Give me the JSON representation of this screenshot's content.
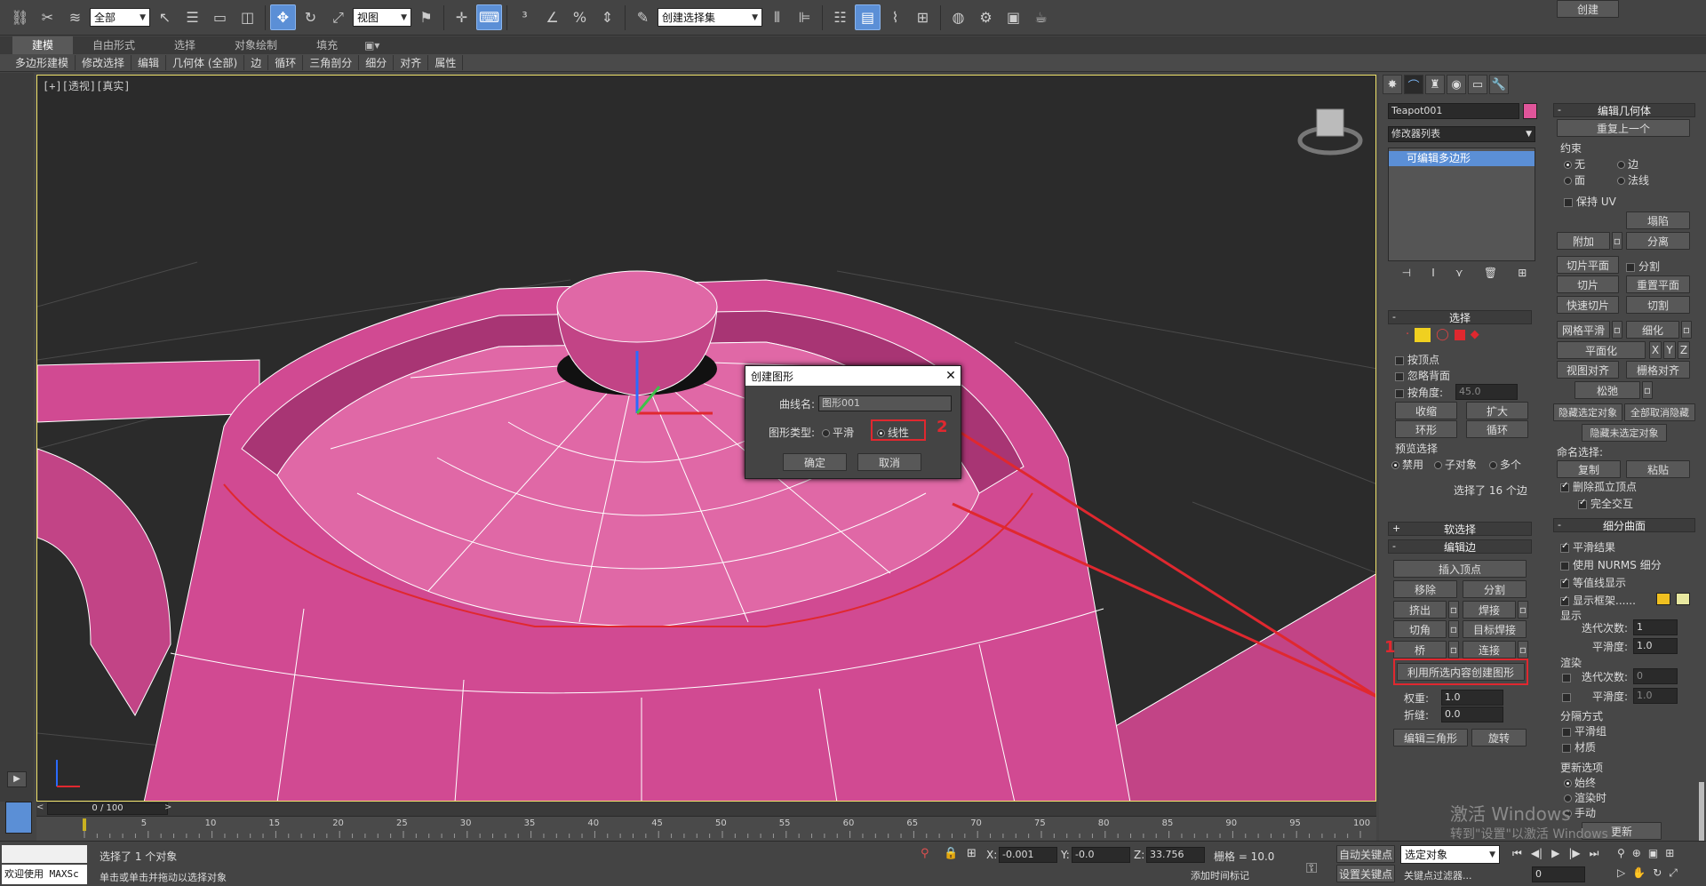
{
  "toolbar": {
    "select_filter": "全部",
    "ref_coord": "视图",
    "named_selection": "创建选择集"
  },
  "ribbon": {
    "tabs": [
      "建模",
      "自由形式",
      "选择",
      "对象绘制",
      "填充"
    ],
    "sub_items": [
      "多边形建模",
      "修改选择",
      "编辑",
      "几何体 (全部)",
      "边",
      "循环",
      "三角剖分",
      "细分",
      "对齐",
      "属性"
    ]
  },
  "viewport": {
    "label": "[+][透视][真实]"
  },
  "dialog": {
    "title": "创建图形",
    "curve_name_label": "曲线名:",
    "curve_name_value": "图形001",
    "shape_type_label": "图形类型:",
    "option_smooth": "平滑",
    "option_linear": "线性",
    "ok_label": "确定",
    "cancel_label": "取消"
  },
  "annotations": {
    "num1": "1",
    "num2": "2"
  },
  "command_panel": {
    "object_name": "Teapot001",
    "modifier_list": "修改器列表",
    "stack_item": "可编辑多边形",
    "selection": {
      "title": "选择",
      "by_vertex": "按顶点",
      "ignore_backface": "忽略背面",
      "by_angle": "按角度:",
      "angle_value": "45.0",
      "shrink": "收缩",
      "grow": "扩大",
      "ring": "环形",
      "loop": "循环",
      "preview_title": "预览选择",
      "preview_off": "禁用",
      "preview_subobj": "子对象",
      "preview_multi": "多个",
      "status": "选择了 16 个边"
    },
    "soft_selection": "软选择",
    "edit_edges": {
      "title": "编辑边",
      "insert_vertex": "插入顶点",
      "remove": "移除",
      "split": "分割",
      "extrude": "挤出",
      "weld": "焊接",
      "chamfer": "切角",
      "target_weld": "目标焊接",
      "bridge": "桥",
      "connect": "连接",
      "create_shape": "利用所选内容创建图形",
      "weight_label": "权重:",
      "weight_value": "1.0",
      "crease_label": "折缝:",
      "crease_value": "0.0",
      "edit_tri": "编辑三角形",
      "turn": "旋转"
    },
    "edit_geometry": {
      "title": "编辑几何体",
      "repeat_last": "重复上一个",
      "constraints": "约束",
      "c_none": "无",
      "c_edge": "边",
      "c_face": "面",
      "c_normal": "法线",
      "preserve_uv": "保持 UV",
      "create": "创建",
      "collapse": "塌陷",
      "attach": "附加",
      "detach": "分离",
      "slice_plane": "切片平面",
      "split": "分割",
      "slice": "切片",
      "reset_plane": "重置平面",
      "quickslice": "快速切片",
      "cut": "切割",
      "meshsmooth": "网格平滑",
      "tessellate": "细化",
      "planarize": "平面化",
      "x": "X",
      "y": "Y",
      "z": "Z",
      "view_align": "视图对齐",
      "grid_align": "栅格对齐",
      "relax": "松弛",
      "hide_sel": "隐藏选定对象",
      "unhide_all": "全部取消隐藏",
      "hide_unsel": "隐藏未选定对象",
      "named_sel": "命名选择:",
      "copy": "复制",
      "paste": "粘贴",
      "delete_iso": "删除孤立顶点",
      "full_interact": "完全交互"
    },
    "subdivision": {
      "title": "细分曲面",
      "smooth_result": "平滑结果",
      "use_nurms": "使用 NURMS 细分",
      "isoline": "等值线显示",
      "show_cage": "显示框架......",
      "display": "显示",
      "iterations": "迭代次数:",
      "iter_value": "1",
      "smoothness": "平滑度:",
      "smooth_value": "1.0",
      "render": "渲染",
      "r_iterations": "迭代次数:",
      "r_iter_value": "0",
      "r_smoothness": "平滑度:",
      "r_smooth_value": "1.0",
      "sep_by": "分隔方式",
      "sm_groups": "平滑组",
      "materials": "材质",
      "update_opts": "更新选项",
      "always": "始终",
      "when_render": "渲染时",
      "manually": "手动",
      "update": "更新"
    }
  },
  "timeline": {
    "frame": "0 / 100",
    "ticks": [
      "5",
      "10",
      "15",
      "20",
      "25",
      "30",
      "35",
      "40",
      "45",
      "50",
      "55",
      "60",
      "65",
      "70",
      "75",
      "80",
      "85",
      "90",
      "95",
      "100"
    ]
  },
  "status": {
    "welcome": "欢迎使用 MAXSc",
    "selected": "选择了 1 个对象",
    "prompt": "单击或单击并拖动以选择对象",
    "x_label": "X:",
    "x_val": "-0.001",
    "y_label": "Y:",
    "y_val": "-0.0",
    "z_label": "Z:",
    "z_val": "33.756",
    "grid": "栅格 = 10.0",
    "auto_key": "自动关键点",
    "set_key": "设置关键点",
    "sel_obj": "选定对象",
    "key_filters": "关键点过滤器...",
    "add_time_tag": "添加时间标记",
    "frame_val": "0"
  },
  "watermark": {
    "line1": "激活 Windows",
    "line2": "转到\"设置\"以激活 Windows"
  },
  "colors": {
    "teapot": "#d14a92",
    "swatch": "#e0559a",
    "accent": "#5b8fd6",
    "annotation": "#e0282f"
  }
}
